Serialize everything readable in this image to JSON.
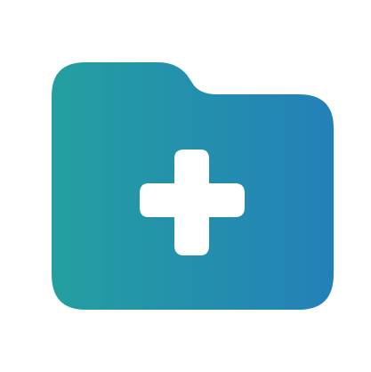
{
  "icon": {
    "name": "add-folder-icon",
    "gradient_start": "#239fa0",
    "gradient_end": "#2480b9",
    "plus_color": "#ffffff",
    "background": "#ffffff"
  }
}
